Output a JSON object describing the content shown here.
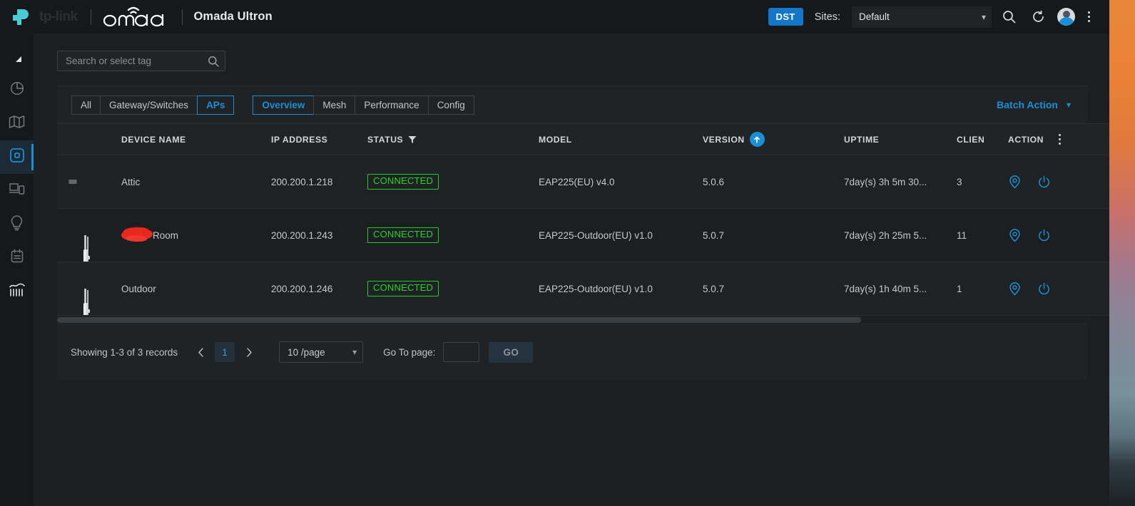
{
  "header": {
    "brand_tp": "tp-link",
    "brand_omada": "omada",
    "app_title": "Omada Ultron",
    "dst_badge": "DST",
    "sites_label": "Sites:",
    "site_selected": "Default",
    "icons": {
      "search": "search-icon",
      "refresh": "refresh-icon",
      "avatar": "user-avatar",
      "more": "more-menu-icon"
    }
  },
  "sidebar": {
    "items": [
      {
        "name": "collapse-toggle",
        "icon": "collapse-arrow-icon"
      },
      {
        "name": "dashboard",
        "icon": "pie-chart-icon"
      },
      {
        "name": "map",
        "icon": "map-icon"
      },
      {
        "name": "devices",
        "icon": "device-square-icon",
        "active": true
      },
      {
        "name": "clients",
        "icon": "clients-icon"
      },
      {
        "name": "insight",
        "icon": "lightbulb-icon"
      },
      {
        "name": "log",
        "icon": "log-list-icon"
      },
      {
        "name": "statistics",
        "icon": "statistics-chart-icon"
      }
    ]
  },
  "search": {
    "placeholder": "Search or select tag",
    "value": "",
    "icon": "search-icon"
  },
  "filters": {
    "device_tabs": [
      {
        "label": "All",
        "selected": false
      },
      {
        "label": "Gateway/Switches",
        "selected": false
      },
      {
        "label": "APs",
        "selected": true
      }
    ],
    "view_tabs": [
      {
        "label": "Overview",
        "selected": true
      },
      {
        "label": "Mesh",
        "selected": false
      },
      {
        "label": "Performance",
        "selected": false
      },
      {
        "label": "Config",
        "selected": false
      }
    ],
    "batch_action": "Batch Action",
    "batch_action_icon": "chevron-down-icon"
  },
  "table": {
    "columns": [
      {
        "key": "icon",
        "label": ""
      },
      {
        "key": "name",
        "label": "DEVICE NAME"
      },
      {
        "key": "ip",
        "label": "IP ADDRESS"
      },
      {
        "key": "status",
        "label": "STATUS",
        "icon": "filter-icon"
      },
      {
        "key": "model",
        "label": "MODEL"
      },
      {
        "key": "version",
        "label": "VERSION",
        "icon": "upgrade-arrow-icon"
      },
      {
        "key": "uptime",
        "label": "UPTIME"
      },
      {
        "key": "clients",
        "label": "CLIEN"
      },
      {
        "key": "action",
        "label": "ACTION",
        "icon": "column-settings-icon"
      }
    ],
    "rows": [
      {
        "device_icon": "ceiling-ap-thumbnail",
        "name": "Attic",
        "name_redacted": false,
        "ip": "200.200.1.218",
        "status": "CONNECTED",
        "model": "EAP225(EU) v4.0",
        "version": "5.0.6",
        "uptime": "7day(s) 3h 5m 30...",
        "clients": "3",
        "actions": [
          "locate-icon",
          "reboot-icon"
        ]
      },
      {
        "device_icon": "outdoor-ap-thumbnail",
        "name": "Room",
        "name_redacted": true,
        "ip": "200.200.1.243",
        "status": "CONNECTED",
        "model": "EAP225-Outdoor(EU) v1.0",
        "version": "5.0.7",
        "uptime": "7day(s) 2h 25m 5...",
        "clients": "11",
        "actions": [
          "locate-icon",
          "reboot-icon"
        ]
      },
      {
        "device_icon": "outdoor-ap-thumbnail",
        "name": "Outdoor",
        "name_redacted": false,
        "ip": "200.200.1.246",
        "status": "CONNECTED",
        "model": "EAP225-Outdoor(EU) v1.0",
        "version": "5.0.7",
        "uptime": "7day(s) 1h 40m 5...",
        "clients": "1",
        "actions": [
          "locate-icon",
          "reboot-icon"
        ]
      }
    ]
  },
  "pagination": {
    "records_text": "Showing 1-3 of 3 records",
    "prev_icon": "chevron-left-icon",
    "next_icon": "chevron-right-icon",
    "current_page": "1",
    "per_page": "10 /page",
    "goto_label": "Go To page:",
    "goto_value": "",
    "go_button": "GO"
  },
  "colors": {
    "accent_blue": "#1b8fd6",
    "status_green": "#25d425",
    "redaction_red": "#e8281e",
    "header_bg": "#16191b",
    "panel_bg": "#1c1f21"
  }
}
